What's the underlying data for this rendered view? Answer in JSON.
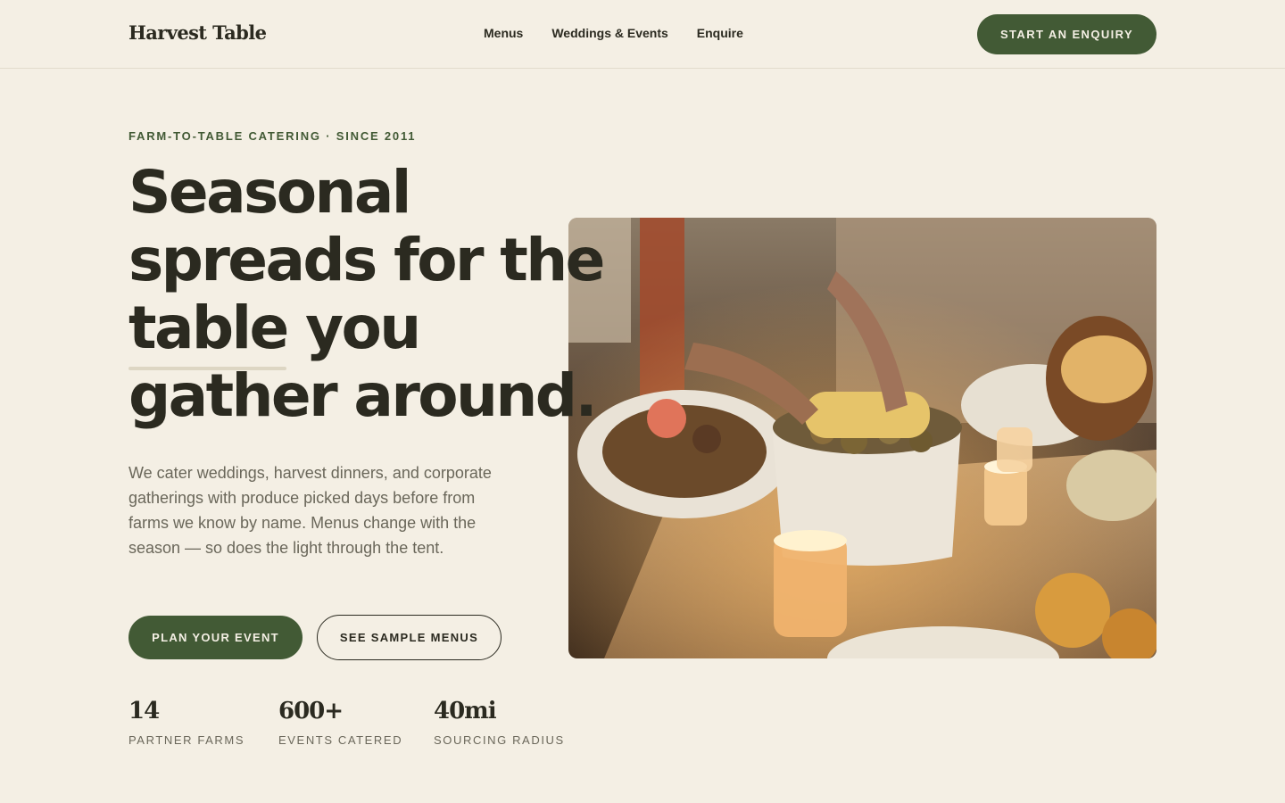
{
  "brand": {
    "name": "Harvest Table"
  },
  "nav": {
    "items": [
      "Menus",
      "Weddings & Events",
      "Enquire"
    ]
  },
  "header": {
    "cta_label": "START AN ENQUIRY"
  },
  "hero": {
    "eyebrow": "FARM-TO-TABLE CATERING · SINCE 2011",
    "headline_lines": [
      "Seasonal",
      "spreads for the",
      "table you",
      "gather around."
    ],
    "lede": "We cater weddings, harvest dinners, and corporate gatherings with produce picked days before from farms we know by name. Menus change with the season — so does the light through the tent.",
    "primary_cta": "PLAN YOUR EVENT",
    "secondary_cta": "SEE SAMPLE MENUS",
    "image_subject": "candlelit-harvest-table-photo"
  },
  "stats": [
    {
      "value": "14",
      "label": "PARTNER FARMS"
    },
    {
      "value": "600+",
      "label": "EVENTS CATERED"
    },
    {
      "value": "40mi",
      "label": "SOURCING RADIUS"
    }
  ],
  "colors": {
    "background": "#f4efe4",
    "accent": "#425a35",
    "text": "#2b2a20",
    "muted": "#6a675a"
  }
}
